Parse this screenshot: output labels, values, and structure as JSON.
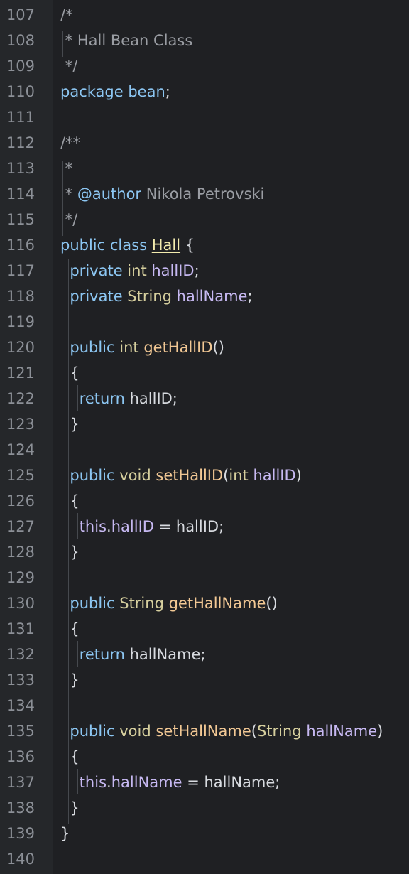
{
  "editor": {
    "language": "Java",
    "colors": {
      "background": "#1f2023",
      "gutter": "#25272a",
      "line_number": "#8c9097",
      "comment": "#9a9da3",
      "keyword": "#8cc6f2",
      "type": "#d6cf9e",
      "field": "#c7b9f2",
      "function": "#f2c894",
      "text": "#d8dbe0",
      "class_name": "#f3ecae"
    },
    "lines": [
      {
        "number": "107",
        "tokens": [
          {
            "text": "/*",
            "kind": "cm"
          }
        ]
      },
      {
        "number": "108",
        "tokens": [
          {
            "text": " * Hall Bean Class",
            "kind": "cm"
          }
        ]
      },
      {
        "number": "109",
        "tokens": [
          {
            "text": " */",
            "kind": "cm"
          }
        ]
      },
      {
        "number": "110",
        "tokens": [
          {
            "text": "package",
            "kind": "kw"
          },
          {
            "text": " ",
            "kind": "tx"
          },
          {
            "text": "bean",
            "kind": "kw"
          },
          {
            "text": ";",
            "kind": "tx"
          }
        ]
      },
      {
        "number": "111",
        "tokens": []
      },
      {
        "number": "112",
        "tokens": [
          {
            "text": "/**",
            "kind": "cm"
          }
        ]
      },
      {
        "number": "113",
        "tokens": [
          {
            "text": " *",
            "kind": "cm"
          }
        ]
      },
      {
        "number": "114",
        "tokens": [
          {
            "text": " * ",
            "kind": "cm"
          },
          {
            "text": "@author",
            "kind": "kw"
          },
          {
            "text": " Nikola Petrovski",
            "kind": "cm"
          }
        ]
      },
      {
        "number": "115",
        "tokens": [
          {
            "text": " */",
            "kind": "cm"
          }
        ]
      },
      {
        "number": "116",
        "tokens": [
          {
            "text": "public",
            "kind": "kw"
          },
          {
            "text": " ",
            "kind": "tx"
          },
          {
            "text": "class",
            "kind": "kw"
          },
          {
            "text": " ",
            "kind": "tx"
          },
          {
            "text": "Hall",
            "kind": "cls"
          },
          {
            "text": " {",
            "kind": "tx"
          }
        ]
      },
      {
        "number": "117",
        "tokens": [
          {
            "text": "  ",
            "kind": "tx"
          },
          {
            "text": "private",
            "kind": "kw"
          },
          {
            "text": " ",
            "kind": "tx"
          },
          {
            "text": "int",
            "kind": "ty"
          },
          {
            "text": " ",
            "kind": "tx"
          },
          {
            "text": "hallID",
            "kind": "fld"
          },
          {
            "text": ";",
            "kind": "tx"
          }
        ]
      },
      {
        "number": "118",
        "tokens": [
          {
            "text": "  ",
            "kind": "tx"
          },
          {
            "text": "private",
            "kind": "kw"
          },
          {
            "text": " ",
            "kind": "tx"
          },
          {
            "text": "String",
            "kind": "ty"
          },
          {
            "text": " ",
            "kind": "tx"
          },
          {
            "text": "hallName",
            "kind": "fld"
          },
          {
            "text": ";",
            "kind": "tx"
          }
        ]
      },
      {
        "number": "119",
        "tokens": []
      },
      {
        "number": "120",
        "tokens": [
          {
            "text": "  ",
            "kind": "tx"
          },
          {
            "text": "public",
            "kind": "kw"
          },
          {
            "text": " ",
            "kind": "tx"
          },
          {
            "text": "int",
            "kind": "ty"
          },
          {
            "text": " ",
            "kind": "tx"
          },
          {
            "text": "getHallID",
            "kind": "fn"
          },
          {
            "text": "()",
            "kind": "tx"
          }
        ]
      },
      {
        "number": "121",
        "tokens": [
          {
            "text": "  {",
            "kind": "tx"
          }
        ]
      },
      {
        "number": "122",
        "tokens": [
          {
            "text": "    ",
            "kind": "tx"
          },
          {
            "text": "return",
            "kind": "kw"
          },
          {
            "text": " hallID;",
            "kind": "tx"
          }
        ]
      },
      {
        "number": "123",
        "tokens": [
          {
            "text": "  }",
            "kind": "tx"
          }
        ]
      },
      {
        "number": "124",
        "tokens": []
      },
      {
        "number": "125",
        "tokens": [
          {
            "text": "  ",
            "kind": "tx"
          },
          {
            "text": "public",
            "kind": "kw"
          },
          {
            "text": " ",
            "kind": "tx"
          },
          {
            "text": "void",
            "kind": "ty"
          },
          {
            "text": " ",
            "kind": "tx"
          },
          {
            "text": "setHallID",
            "kind": "fn"
          },
          {
            "text": "(",
            "kind": "tx"
          },
          {
            "text": "int",
            "kind": "ty"
          },
          {
            "text": " ",
            "kind": "tx"
          },
          {
            "text": "hallID",
            "kind": "fld"
          },
          {
            "text": ")",
            "kind": "tx"
          }
        ]
      },
      {
        "number": "126",
        "tokens": [
          {
            "text": "  {",
            "kind": "tx"
          }
        ]
      },
      {
        "number": "127",
        "tokens": [
          {
            "text": "    ",
            "kind": "tx"
          },
          {
            "text": "this",
            "kind": "fld"
          },
          {
            "text": ".",
            "kind": "tx"
          },
          {
            "text": "hallID",
            "kind": "fld"
          },
          {
            "text": " = hallID;",
            "kind": "tx"
          }
        ]
      },
      {
        "number": "128",
        "tokens": [
          {
            "text": "  }",
            "kind": "tx"
          }
        ]
      },
      {
        "number": "129",
        "tokens": []
      },
      {
        "number": "130",
        "tokens": [
          {
            "text": "  ",
            "kind": "tx"
          },
          {
            "text": "public",
            "kind": "kw"
          },
          {
            "text": " ",
            "kind": "tx"
          },
          {
            "text": "String",
            "kind": "ty"
          },
          {
            "text": " ",
            "kind": "tx"
          },
          {
            "text": "getHallName",
            "kind": "fn"
          },
          {
            "text": "()",
            "kind": "tx"
          }
        ]
      },
      {
        "number": "131",
        "tokens": [
          {
            "text": "  {",
            "kind": "tx"
          }
        ]
      },
      {
        "number": "132",
        "tokens": [
          {
            "text": "    ",
            "kind": "tx"
          },
          {
            "text": "return",
            "kind": "kw"
          },
          {
            "text": " hallName;",
            "kind": "tx"
          }
        ]
      },
      {
        "number": "133",
        "tokens": [
          {
            "text": "  }",
            "kind": "tx"
          }
        ]
      },
      {
        "number": "134",
        "tokens": []
      },
      {
        "number": "135",
        "tokens": [
          {
            "text": "  ",
            "kind": "tx"
          },
          {
            "text": "public",
            "kind": "kw"
          },
          {
            "text": " ",
            "kind": "tx"
          },
          {
            "text": "void",
            "kind": "ty"
          },
          {
            "text": " ",
            "kind": "tx"
          },
          {
            "text": "setHallName",
            "kind": "fn"
          },
          {
            "text": "(",
            "kind": "tx"
          },
          {
            "text": "String",
            "kind": "ty"
          },
          {
            "text": " ",
            "kind": "tx"
          },
          {
            "text": "hallName",
            "kind": "fld"
          },
          {
            "text": ")",
            "kind": "tx"
          }
        ]
      },
      {
        "number": "136",
        "tokens": [
          {
            "text": "  {",
            "kind": "tx"
          }
        ]
      },
      {
        "number": "137",
        "tokens": [
          {
            "text": "    ",
            "kind": "tx"
          },
          {
            "text": "this",
            "kind": "fld"
          },
          {
            "text": ".",
            "kind": "tx"
          },
          {
            "text": "hallName",
            "kind": "fld"
          },
          {
            "text": " = hallName;",
            "kind": "tx"
          }
        ]
      },
      {
        "number": "138",
        "tokens": [
          {
            "text": "  }",
            "kind": "tx"
          }
        ]
      },
      {
        "number": "139",
        "tokens": [
          {
            "text": "}",
            "kind": "tx"
          }
        ]
      },
      {
        "number": "140",
        "tokens": []
      }
    ]
  }
}
